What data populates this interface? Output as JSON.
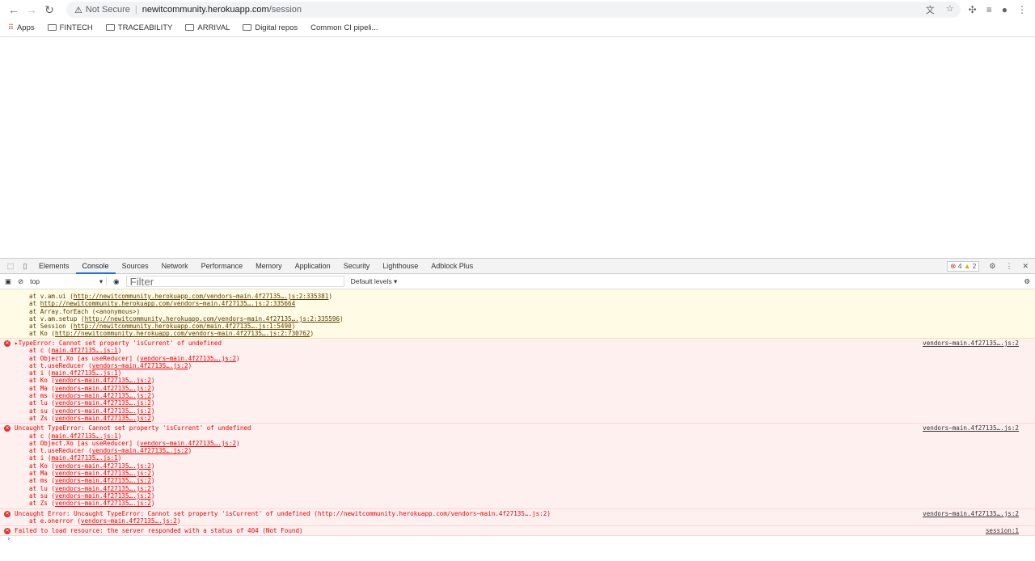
{
  "browser": {
    "security_label": "Not Secure",
    "url_host": "newitcommunity.herokuapp.com",
    "url_path": "/session"
  },
  "bookmarks": [
    {
      "label": "Apps"
    },
    {
      "label": "FINTECH"
    },
    {
      "label": "TRACEABILITY"
    },
    {
      "label": "ARRIVAL"
    },
    {
      "label": "Digital repos"
    },
    {
      "label": "Common CI pipeli..."
    }
  ],
  "devtools": {
    "tabs": [
      "Elements",
      "Console",
      "Sources",
      "Network",
      "Performance",
      "Memory",
      "Application",
      "Security",
      "Lighthouse",
      "Adblock Plus"
    ],
    "active_tab": "Console",
    "error_count": "4",
    "warning_count": "2",
    "context": "top",
    "filter_placeholder": "Filter",
    "levels": "Default levels ▾"
  },
  "console": {
    "warning_frames": [
      {
        "pre": "at v.am.ui (",
        "link": "http://newitcommunity.herokuapp.com/vendors~main.4f27135….js:2:335381",
        "post": ")"
      },
      {
        "pre": "at ",
        "link": "http://newitcommunity.herokuapp.com/vendors~main.4f27135….js:2:335664",
        "post": ""
      },
      {
        "pre": "at Array.forEach (<anonymous>)",
        "link": "",
        "post": ""
      },
      {
        "pre": "at v.am.setup (",
        "link": "http://newitcommunity.herokuapp.com/vendors~main.4f27135….js:2:335596",
        "post": ")"
      },
      {
        "pre": "at Session (",
        "link": "http://newitcommunity.herokuapp.com/main.4f27135….js:1:5490",
        "post": ")"
      },
      {
        "pre": "at Ko (",
        "link": "http://newitcommunity.herokuapp.com/vendors~main.4f27135….js:2:730762",
        "post": ")"
      }
    ],
    "errors": [
      {
        "text": "▸TypeError: Cannot set property 'isCurrent' of undefined",
        "source": "vendors~main.4f27135….js:2",
        "frames": [
          {
            "pre": "at c (",
            "link": "main.4f27135….js:1",
            "post": ")"
          },
          {
            "pre": "at Object.Xo [as useReducer] (",
            "link": "vendors~main.4f27135….js:2",
            "post": ")"
          },
          {
            "pre": "at t.useReducer (",
            "link": "vendors~main.4f27135….js:2",
            "post": ")"
          },
          {
            "pre": "at i (",
            "link": "main.4f27135….js:1",
            "post": ")"
          },
          {
            "pre": "at Ko (",
            "link": "vendors~main.4f27135….js:2",
            "post": ")"
          },
          {
            "pre": "at Ma (",
            "link": "vendors~main.4f27135….js:2",
            "post": ")"
          },
          {
            "pre": "at ms (",
            "link": "vendors~main.4f27135….js:2",
            "post": ")"
          },
          {
            "pre": "at lu (",
            "link": "vendors~main.4f27135….js:2",
            "post": ")"
          },
          {
            "pre": "at su (",
            "link": "vendors~main.4f27135….js:2",
            "post": ")"
          },
          {
            "pre": "at Zs (",
            "link": "vendors~main.4f27135….js:2",
            "post": ")"
          }
        ]
      },
      {
        "text": "Uncaught TypeError: Cannot set property 'isCurrent' of undefined",
        "source": "vendors~main.4f27135….js:2",
        "frames": [
          {
            "pre": "at c (",
            "link": "main.4f27135….js:1",
            "post": ")"
          },
          {
            "pre": "at Object.Xo [as useReducer] (",
            "link": "vendors~main.4f27135….js:2",
            "post": ")"
          },
          {
            "pre": "at t.useReducer (",
            "link": "vendors~main.4f27135….js:2",
            "post": ")"
          },
          {
            "pre": "at i (",
            "link": "main.4f27135….js:1",
            "post": ")"
          },
          {
            "pre": "at Ko (",
            "link": "vendors~main.4f27135….js:2",
            "post": ")"
          },
          {
            "pre": "at Ma (",
            "link": "vendors~main.4f27135….js:2",
            "post": ")"
          },
          {
            "pre": "at ms (",
            "link": "vendors~main.4f27135….js:2",
            "post": ")"
          },
          {
            "pre": "at lu (",
            "link": "vendors~main.4f27135….js:2",
            "post": ")"
          },
          {
            "pre": "at su (",
            "link": "vendors~main.4f27135….js:2",
            "post": ")"
          },
          {
            "pre": "at Zs (",
            "link": "vendors~main.4f27135….js:2",
            "post": ")"
          }
        ]
      },
      {
        "text": "Uncaught Error: Uncaught TypeError: Cannot set property 'isCurrent' of undefined (http://newitcommunity.herokuapp.com/vendors~main.4f27135….js:2)",
        "source": "vendors~main.4f27135….js:2",
        "frames": [
          {
            "pre": "at e.onerror (",
            "link": "vendors~main.4f27135….js:2",
            "post": ")"
          }
        ]
      },
      {
        "text": "Failed to load resource: the server responded with a status of 404 (Not Found)",
        "source": "session:1",
        "frames": []
      }
    ],
    "prompt": "›"
  }
}
